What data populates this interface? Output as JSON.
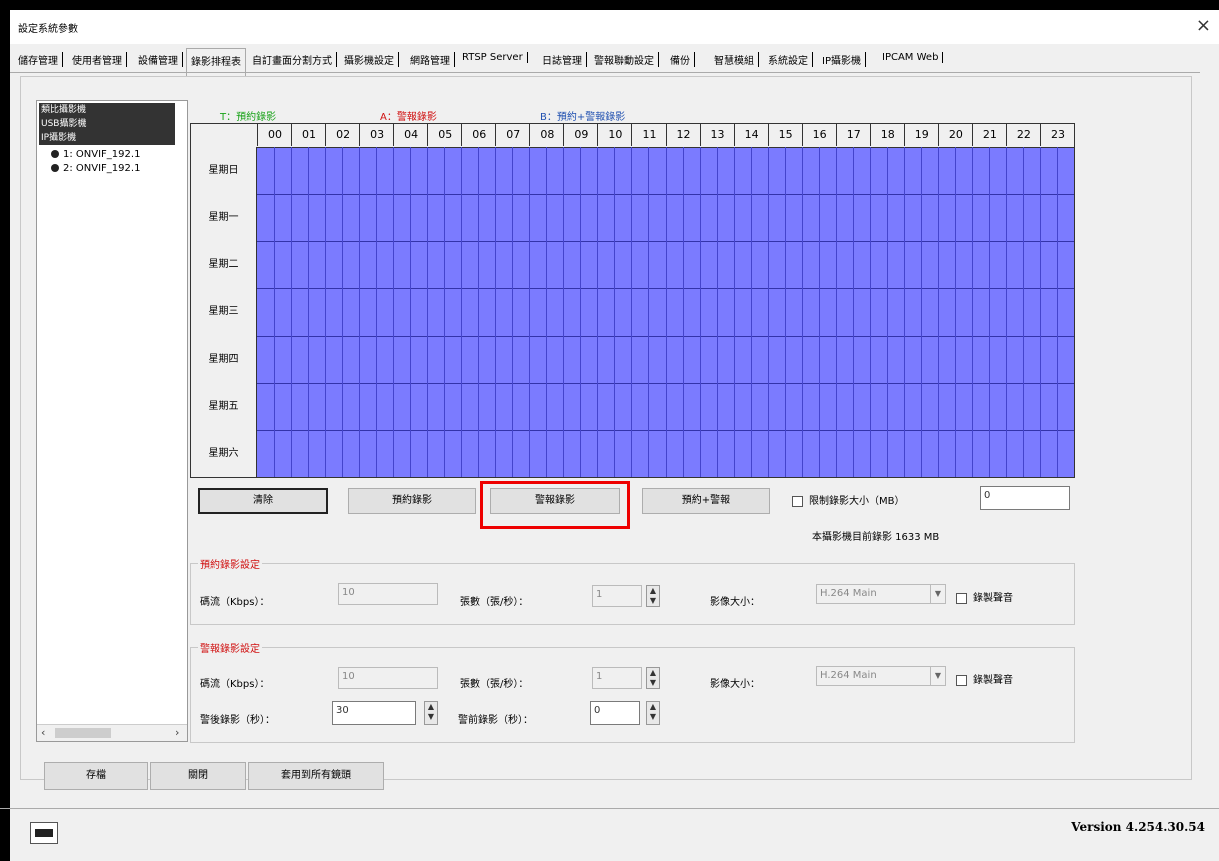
{
  "window": {
    "title": "設定系統參數",
    "close_glyph": "×"
  },
  "tabs": [
    {
      "label": "儲存管理"
    },
    {
      "label": "使用者管理"
    },
    {
      "label": "設備管理"
    },
    {
      "label": "錄影排程表",
      "active": true
    },
    {
      "label": "自訂畫面分割方式"
    },
    {
      "label": "攝影機設定"
    },
    {
      "label": "網路管理"
    },
    {
      "label": "RTSP Server"
    },
    {
      "label": "日誌管理"
    },
    {
      "label": "警報聯動設定"
    },
    {
      "label": "備份"
    },
    {
      "label": "智慧模組"
    },
    {
      "label": "系統設定"
    },
    {
      "label": "IP攝影機"
    },
    {
      "label": "IPCAM Web"
    }
  ],
  "tree": {
    "groups": [
      "類比攝影機",
      "USB攝影機",
      "IP攝影機"
    ],
    "cameras": [
      "1: ONVIF_192.1",
      "2: ONVIF_192.1"
    ],
    "scroll_left": "‹",
    "scroll_right": "›"
  },
  "legend": {
    "t": {
      "text": "T：預約錄影",
      "color": "#1aa31a"
    },
    "a": {
      "text": "A：警報錄影",
      "color": "#d01010"
    },
    "b": {
      "text": "B：預約+警報錄影",
      "color": "#2050b0"
    }
  },
  "schedule": {
    "hours": [
      "00",
      "01",
      "02",
      "03",
      "04",
      "05",
      "06",
      "07",
      "08",
      "09",
      "10",
      "11",
      "12",
      "13",
      "14",
      "15",
      "16",
      "17",
      "18",
      "19",
      "20",
      "21",
      "22",
      "23"
    ],
    "days": [
      "星期日",
      "星期一",
      "星期二",
      "星期三",
      "星期四",
      "星期五",
      "星期六"
    ],
    "fill_color": "#7b7bff"
  },
  "actions": {
    "clear": "清除",
    "scheduled": "預約錄影",
    "alarm": "警報錄影",
    "scheduled_alarm": "預約+警報",
    "limit_label": "限制錄影大小（MB）",
    "limit_value": "0",
    "current_usage": "本攝影機目前錄影 1633 MB"
  },
  "scheduled_settings": {
    "title": "預約錄影設定",
    "bitrate_label": "碼流（Kbps）：",
    "bitrate_value": "10",
    "fps_label": "張數（張/秒）：",
    "fps_value": "1",
    "size_label": "影像大小：",
    "size_value": "H.264 Main",
    "audio_label": "錄製聲音"
  },
  "alarm_settings": {
    "title": "警報錄影設定",
    "bitrate_label": "碼流（Kbps）：",
    "bitrate_value": "10",
    "fps_label": "張數（張/秒）：",
    "fps_value": "1",
    "size_label": "影像大小：",
    "size_value": "H.264 Main",
    "audio_label": "錄製聲音",
    "post_label": "警後錄影（秒）：",
    "post_value": "30",
    "pre_label": "警前錄影（秒）：",
    "pre_value": "0"
  },
  "footer": {
    "save": "存檔",
    "close": "關閉",
    "apply_all": "套用到所有鏡頭",
    "version": "Version 4.254.30.54"
  }
}
